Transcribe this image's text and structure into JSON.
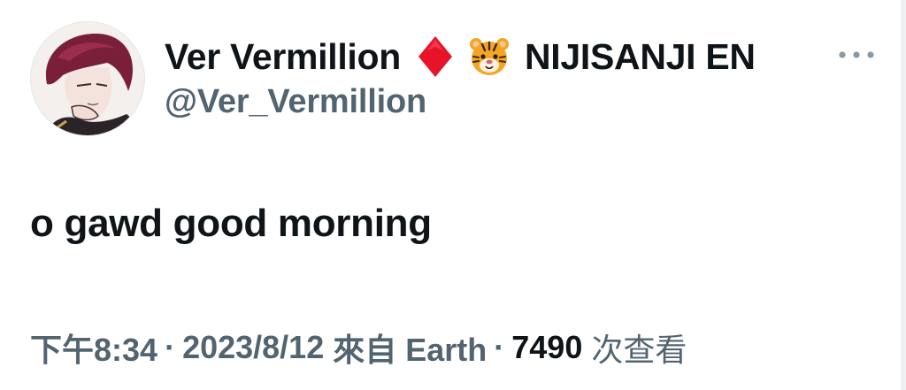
{
  "author": {
    "display_name": "Ver Vermillion",
    "badge_icon": "red-diamond-icon",
    "animal_icon": "tiger-face-icon",
    "org_name": "NIJISANJI EN",
    "handle": "@Ver_Vermillion"
  },
  "tweet": {
    "text": "o gawd good morning"
  },
  "meta": {
    "time": "下午8:34",
    "separator": "·",
    "date": "2023/8/12",
    "source_label": "來自 Earth",
    "views_count": "7490",
    "views_label": "次查看"
  },
  "icons": {
    "more": "more-horizontal-icon"
  },
  "colors": {
    "text_primary": "#0f1419",
    "text_secondary": "#536471",
    "diamond": "#e8132a",
    "icon_gray": "#8b98a5"
  }
}
